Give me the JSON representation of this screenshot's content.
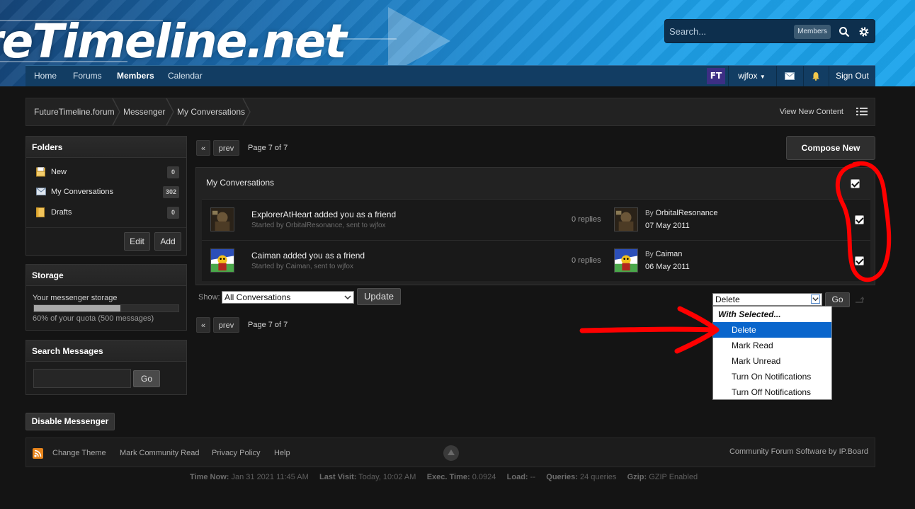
{
  "header": {
    "logo": "reTimeline.net",
    "search": {
      "placeholder": "Search...",
      "scope": "Members"
    },
    "nav": [
      "Home",
      "Forums",
      "Members",
      "Calendar"
    ],
    "user": {
      "badge": "FT",
      "name": "wjfox",
      "signout": "Sign Out"
    }
  },
  "breadcrumb": [
    "FutureTimeline.forum",
    "Messenger",
    "My Conversations"
  ],
  "view_new": "View New Content",
  "sidebar": {
    "folders_title": "Folders",
    "folders": [
      {
        "label": "New",
        "count": "0"
      },
      {
        "label": "My Conversations",
        "count": "302"
      },
      {
        "label": "Drafts",
        "count": "0"
      }
    ],
    "edit": "Edit",
    "add": "Add",
    "storage_title": "Storage",
    "storage_label": "Your messenger storage",
    "storage_pct": 0.6,
    "storage_quota": "60% of your quota (500 messages)",
    "search_title": "Search Messages",
    "search_go": "Go",
    "disable": "Disable Messenger"
  },
  "pager": {
    "first": "«",
    "prev": "prev",
    "label": "Page 7 of 7"
  },
  "compose": "Compose New",
  "conversations": {
    "title": "My Conversations",
    "rows": [
      {
        "subject": "ExplorerAtHeart added you as a friend",
        "meta": "Started by OrbitalResonance, sent to wjfox",
        "replies": "0 replies",
        "by_prefix": "By",
        "by": "OrbitalResonance",
        "date": "07 May 2011"
      },
      {
        "subject": "Caiman added you as a friend",
        "meta": "Started by Caiman, sent to wjfox",
        "replies": "0 replies",
        "by_prefix": "By",
        "by": "Caiman",
        "date": "06 May 2011"
      }
    ]
  },
  "filter": {
    "show_label": "Show:",
    "value": "All Conversations",
    "update": "Update"
  },
  "bulk": {
    "value": "Delete",
    "go": "Go",
    "options": [
      "With Selected...",
      "Delete",
      "Mark Read",
      "Mark Unread",
      "Turn On Notifications",
      "Turn Off Notifications"
    ]
  },
  "footer": {
    "links": [
      "Change Theme",
      "Mark Community Read",
      "Privacy Policy",
      "Help"
    ],
    "credit": "Community Forum Software by IP.Board"
  },
  "stats": {
    "time_now_label": "Time Now:",
    "time_now": "Jan 31 2021 11:45 AM",
    "last_visit_label": "Last Visit:",
    "last_visit": "Today, 10:02 AM",
    "exec_label": "Exec. Time:",
    "exec": "0.0924",
    "load_label": "Load:",
    "load": "--",
    "queries_label": "Queries:",
    "queries": "24 queries",
    "gzip_label": "Gzip:",
    "gzip": "GZIP Enabled"
  },
  "colors": {
    "header_blue": "#1e8ed6",
    "nav_blue": "#123d63",
    "select_blue": "#0a66cc",
    "annotation_red": "#ff0000"
  }
}
